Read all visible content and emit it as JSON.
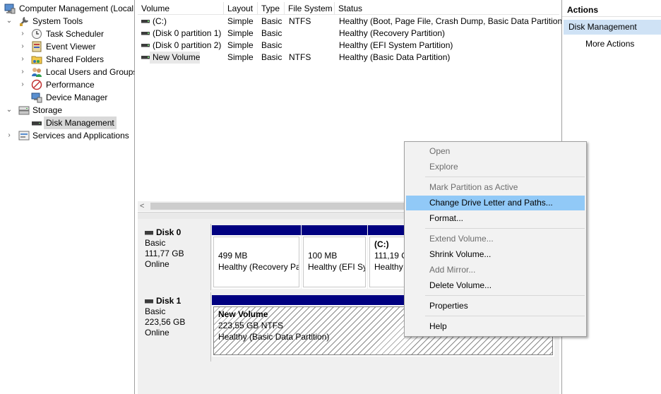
{
  "tree": {
    "items": [
      {
        "label": "Computer Management (Local",
        "icon": "computer-management-icon"
      },
      {
        "label": "System Tools",
        "icon": "system-tools-icon"
      },
      {
        "label": "Task Scheduler",
        "icon": "clock-icon"
      },
      {
        "label": "Event Viewer",
        "icon": "event-viewer-icon"
      },
      {
        "label": "Shared Folders",
        "icon": "shared-folder-icon"
      },
      {
        "label": "Local Users and Groups",
        "icon": "users-icon"
      },
      {
        "label": "Performance",
        "icon": "performance-icon"
      },
      {
        "label": "Device Manager",
        "icon": "device-manager-icon"
      },
      {
        "label": "Storage",
        "icon": "storage-icon"
      },
      {
        "label": "Disk Management",
        "icon": "disk-icon"
      },
      {
        "label": "Services and Applications",
        "icon": "services-icon"
      }
    ]
  },
  "volumes": {
    "columns": [
      "Volume",
      "Layout",
      "Type",
      "File System",
      "Status"
    ],
    "rows": [
      {
        "volume": "(C:)",
        "layout": "Simple",
        "type": "Basic",
        "fs": "NTFS",
        "status": "Healthy (Boot, Page File, Crash Dump, Basic Data Partition)"
      },
      {
        "volume": "(Disk 0 partition 1)",
        "layout": "Simple",
        "type": "Basic",
        "fs": "",
        "status": "Healthy (Recovery Partition)"
      },
      {
        "volume": "(Disk 0 partition 2)",
        "layout": "Simple",
        "type": "Basic",
        "fs": "",
        "status": "Healthy (EFI System Partition)"
      },
      {
        "volume": "New Volume",
        "layout": "Simple",
        "type": "Basic",
        "fs": "NTFS",
        "status": "Healthy (Basic Data Partition)"
      }
    ]
  },
  "scroll": {
    "left_arrow": "<"
  },
  "disks": [
    {
      "name": "Disk 0",
      "type": "Basic",
      "size": "111,77 GB",
      "state": "Online",
      "partitions": [
        {
          "title": "",
          "line1": "499 MB",
          "line2": "Healthy (Recovery Pa"
        },
        {
          "title": "",
          "line1": "100 MB",
          "line2": "Healthy (EFI Sy"
        },
        {
          "title": "(C:)",
          "line1": "111,19 G",
          "line2": "Healthy"
        }
      ]
    },
    {
      "name": "Disk 1",
      "type": "Basic",
      "size": "223,56 GB",
      "state": "Online",
      "partitions": [
        {
          "title": "New Volume",
          "line1": "223,55 GB NTFS",
          "line2": "Healthy (Basic Data Partition)"
        }
      ]
    }
  ],
  "actions": {
    "title": "Actions",
    "section": "Disk Management",
    "more": "More Actions"
  },
  "context_menu": {
    "items": [
      {
        "label": "Open",
        "enabled": false
      },
      {
        "label": "Explore",
        "enabled": false
      },
      {
        "label": "Mark Partition as Active",
        "enabled": false
      },
      {
        "label": "Change Drive Letter and Paths...",
        "enabled": true,
        "highlighted": true
      },
      {
        "label": "Format...",
        "enabled": true
      },
      {
        "label": "Extend Volume...",
        "enabled": false
      },
      {
        "label": "Shrink Volume...",
        "enabled": true
      },
      {
        "label": "Add Mirror...",
        "enabled": false
      },
      {
        "label": "Delete Volume...",
        "enabled": true
      },
      {
        "label": "Properties",
        "enabled": true
      },
      {
        "label": "Help",
        "enabled": true
      }
    ]
  },
  "colors": {
    "partition_bar": "#000080",
    "menu_highlight": "#91c9f7",
    "tree_selection": "#d9d9d9",
    "actions_section": "#cfe2f5"
  }
}
